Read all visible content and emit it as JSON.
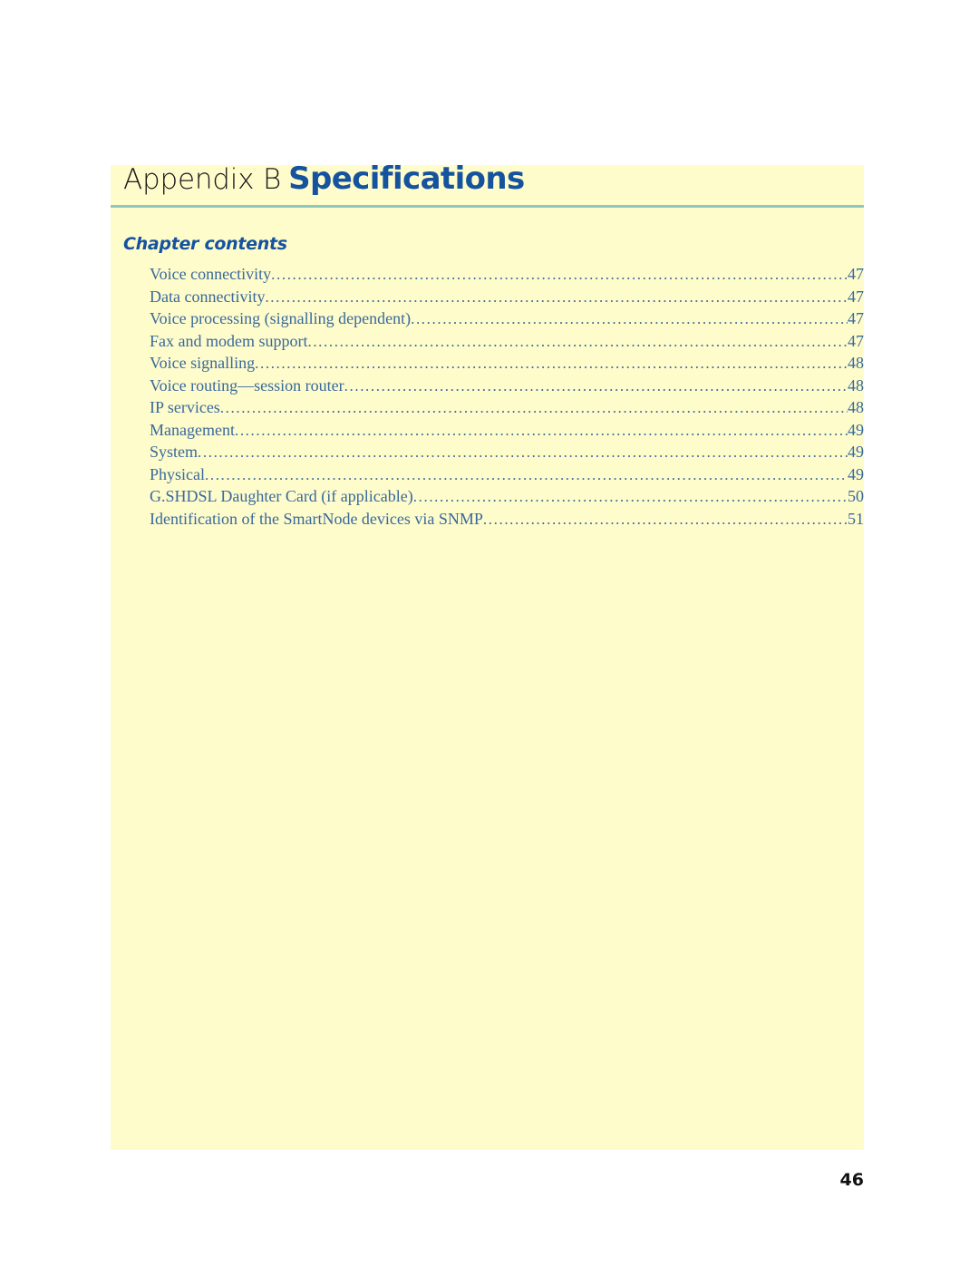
{
  "page": {
    "folio": "46",
    "background_color": "#ffffff",
    "block_color": "#fffccc",
    "rule_color": "#8cc8c0",
    "heading_color": "#15539e",
    "toc_color": "#37699c"
  },
  "title": {
    "prefix": "Appendix B",
    "main": "Specifications"
  },
  "chapter_contents": {
    "heading": "Chapter contents",
    "entries": [
      {
        "label": "Voice connectivity",
        "page": "47"
      },
      {
        "label": "Data connectivity",
        "page": "47"
      },
      {
        "label": "Voice processing (signalling dependent)",
        "page": "47"
      },
      {
        "label": "Fax and modem support",
        "page": "47"
      },
      {
        "label": "Voice signalling",
        "page": "48"
      },
      {
        "label": "Voice routing—session router",
        "page": "48"
      },
      {
        "label": "IP services",
        "page": "48"
      },
      {
        "label": "Management",
        "page": "49"
      },
      {
        "label": "System",
        "page": "49"
      },
      {
        "label": "Physical",
        "page": "49"
      },
      {
        "label": "G.SHDSL Daughter Card (if applicable)",
        "page": "50"
      },
      {
        "label": "Identification of the SmartNode devices via SNMP",
        "page": "51"
      }
    ]
  }
}
